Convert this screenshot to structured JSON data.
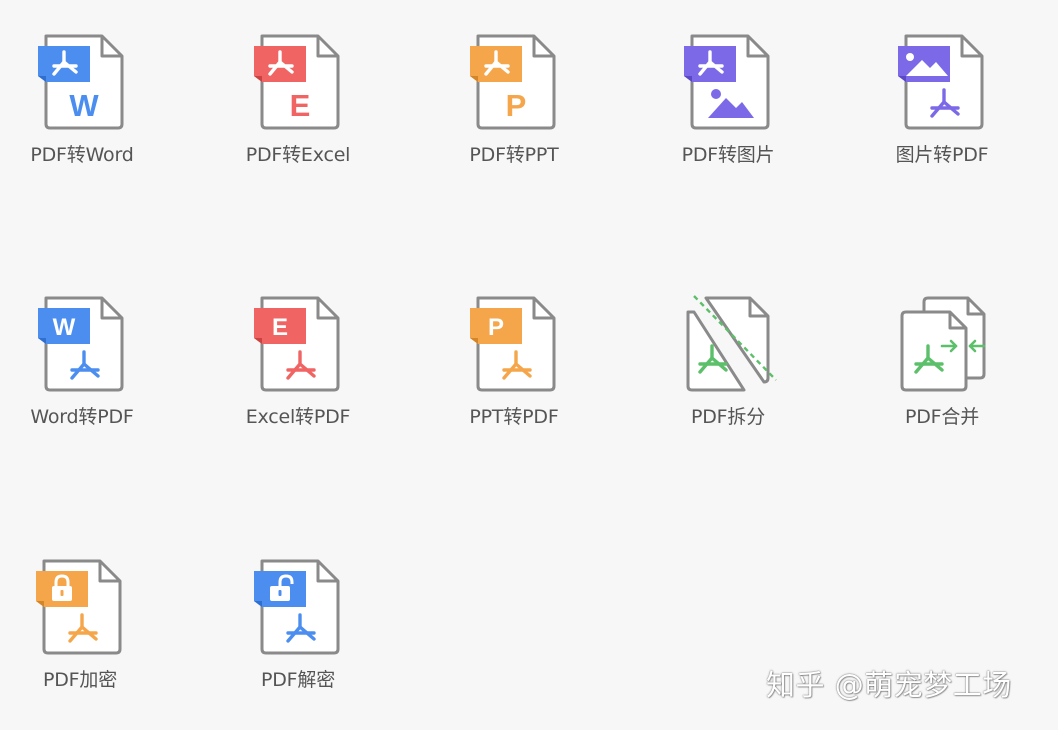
{
  "colors": {
    "word": "#4c8ef0",
    "excel": "#f06464",
    "ppt": "#f5a64a",
    "image": "#7b69e8",
    "merge": "#5cbf6a",
    "outline": "#8a8a8a",
    "label": "#555555",
    "background": "#f7f7f7"
  },
  "tools": [
    {
      "label": "PDF转Word",
      "icon": "pdf-to-word-icon"
    },
    {
      "label": "PDF转Excel",
      "icon": "pdf-to-excel-icon"
    },
    {
      "label": "PDF转PPT",
      "icon": "pdf-to-ppt-icon"
    },
    {
      "label": "PDF转图片",
      "icon": "pdf-to-image-icon"
    },
    {
      "label": "图片转PDF",
      "icon": "image-to-pdf-icon"
    },
    {
      "label": "Word转PDF",
      "icon": "word-to-pdf-icon"
    },
    {
      "label": "Excel转PDF",
      "icon": "excel-to-pdf-icon"
    },
    {
      "label": "PPT转PDF",
      "icon": "ppt-to-pdf-icon"
    },
    {
      "label": "PDF拆分",
      "icon": "pdf-split-icon"
    },
    {
      "label": "PDF合并",
      "icon": "pdf-merge-icon"
    },
    {
      "label": "PDF加密",
      "icon": "pdf-encrypt-icon"
    },
    {
      "label": "PDF解密",
      "icon": "pdf-decrypt-icon"
    }
  ],
  "icon_letters": {
    "word": "W",
    "excel": "E",
    "ppt": "P"
  },
  "watermark": "知乎 @萌宠梦工场"
}
